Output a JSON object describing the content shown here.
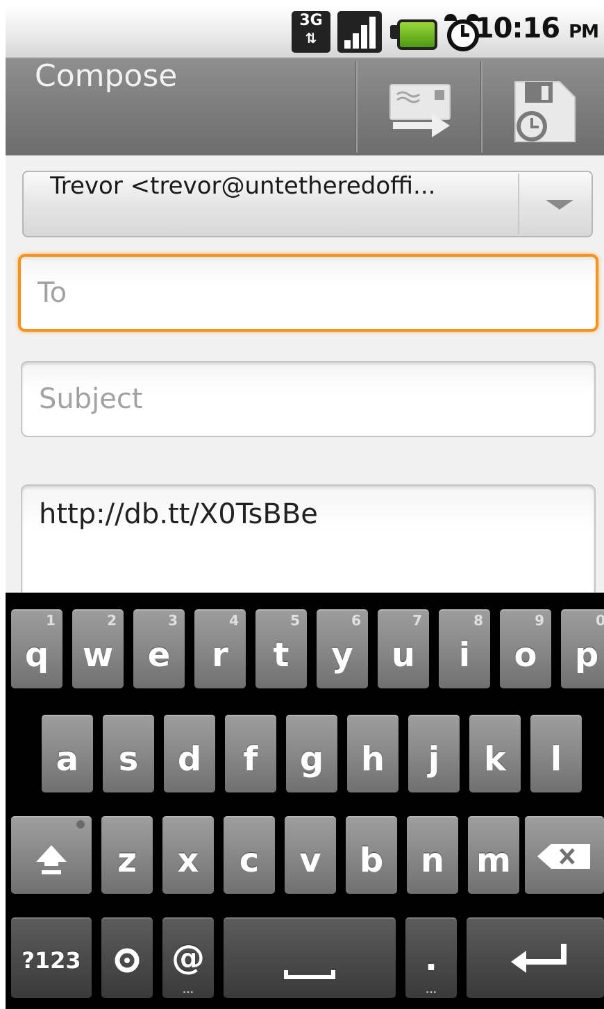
{
  "status_bar": {
    "network_label": "3G",
    "time": "10:16",
    "ampm": "PM"
  },
  "title_bar": {
    "title": "Compose"
  },
  "compose": {
    "from_account": "Trevor  <trevor@untetheredoffi...",
    "to_placeholder": "To",
    "subject_placeholder": "Subject",
    "body_text": "http://db.tt/X0TsBBe"
  },
  "keyboard": {
    "row1": [
      {
        "letter": "q",
        "num": "1"
      },
      {
        "letter": "w",
        "num": "2"
      },
      {
        "letter": "e",
        "num": "3"
      },
      {
        "letter": "r",
        "num": "4"
      },
      {
        "letter": "t",
        "num": "5"
      },
      {
        "letter": "y",
        "num": "6"
      },
      {
        "letter": "u",
        "num": "7"
      },
      {
        "letter": "i",
        "num": "8"
      },
      {
        "letter": "o",
        "num": "9"
      },
      {
        "letter": "p",
        "num": "0"
      }
    ],
    "row2": [
      "a",
      "s",
      "d",
      "f",
      "g",
      "h",
      "j",
      "k",
      "l"
    ],
    "row3": [
      "z",
      "x",
      "c",
      "v",
      "b",
      "n",
      "m"
    ],
    "symbols_key": "?123",
    "at_key": "@",
    "period_key": ".",
    "ellipsis": "..."
  },
  "colors": {
    "focus_accent": "#f6921e",
    "battery": "#7cc22a"
  }
}
